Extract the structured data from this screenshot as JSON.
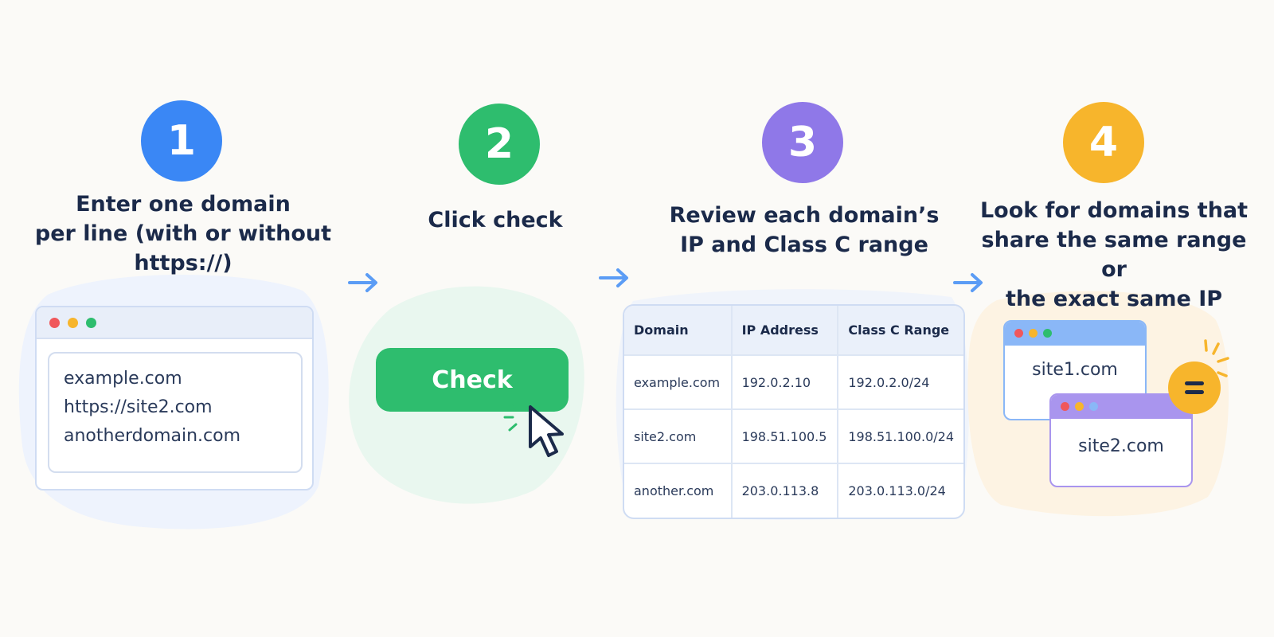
{
  "steps": [
    {
      "number": "1",
      "color": "#3a87f5",
      "title_lines": [
        "Enter one domain",
        "per line (with or without",
        "https://)"
      ]
    },
    {
      "number": "2",
      "color": "#2ebd6e",
      "title_lines": [
        "Click check"
      ]
    },
    {
      "number": "3",
      "color": "#8f78e8",
      "title_lines": [
        "Review each domain’s",
        "IP and Class C range"
      ]
    },
    {
      "number": "4",
      "color": "#f7b52c",
      "title_lines": [
        "Look for domains that",
        "share the same range or",
        "the exact same IP"
      ]
    }
  ],
  "step1": {
    "lines": [
      "example.com",
      "https://site2.com",
      "anotherdomain.com"
    ]
  },
  "step2": {
    "button_label": "Check"
  },
  "step3": {
    "headers": [
      "Domain",
      "IP Address",
      "Class C Range"
    ],
    "rows": [
      [
        "example.com",
        "192.0.2.10",
        "192.0.2.0/24"
      ],
      [
        "site2.com",
        "198.51.100.5",
        "198.51.100.0/24"
      ],
      [
        "another.com",
        "203.0.113.8",
        "203.0.113.0/24"
      ]
    ]
  },
  "step4": {
    "site_a": "site1.com",
    "site_b": "site2.com"
  },
  "colors": {
    "blue": "#3a87f5",
    "green": "#2ebd6e",
    "purple": "#8f78e8",
    "orange": "#f7b52c",
    "navy": "#1b2a4a"
  }
}
